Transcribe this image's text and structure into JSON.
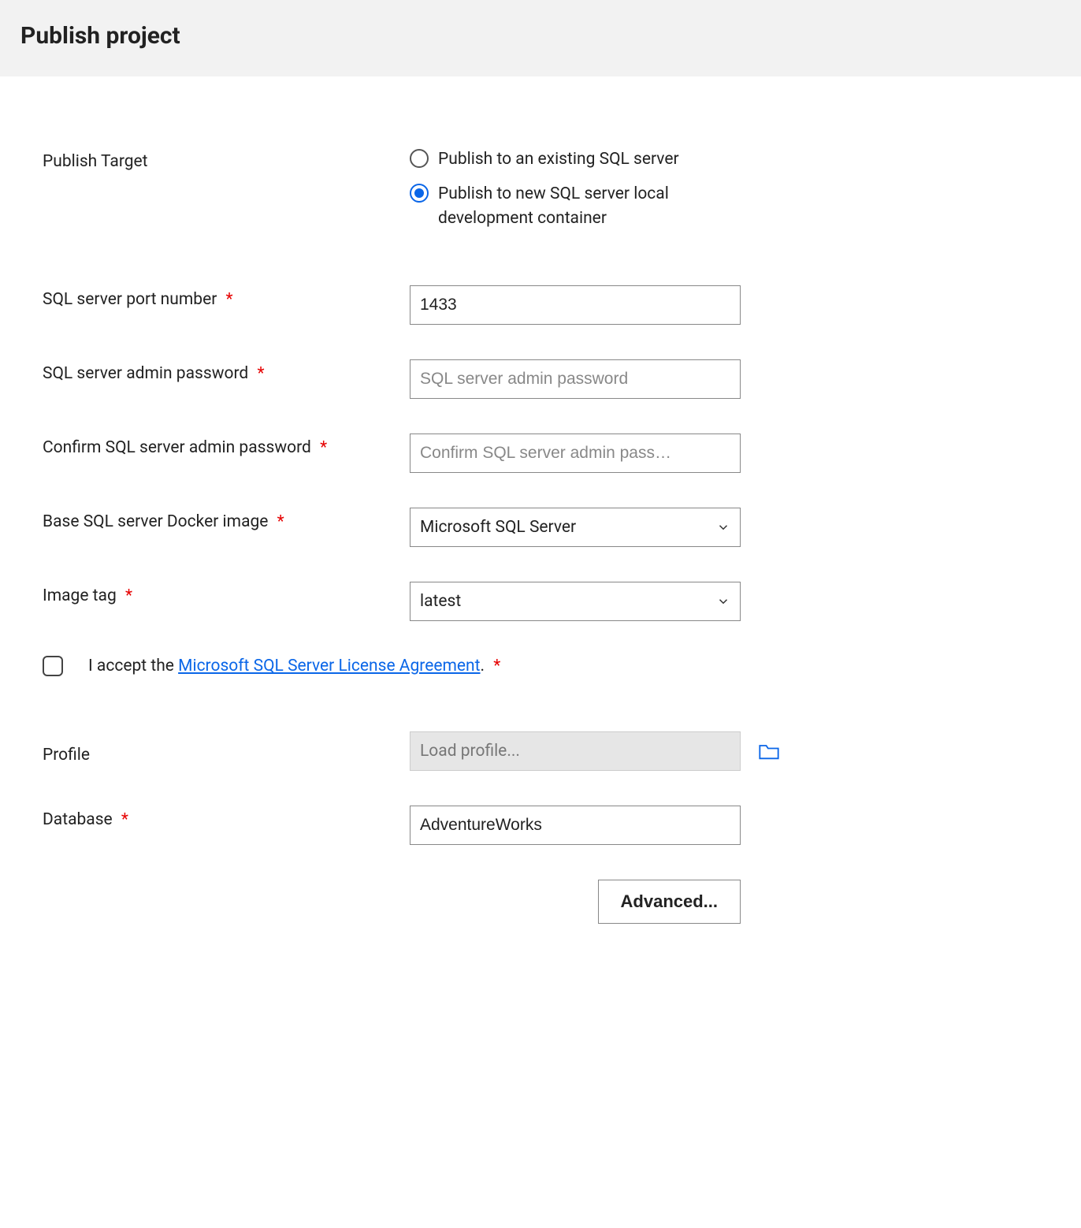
{
  "header": {
    "title": "Publish project"
  },
  "publishTarget": {
    "label": "Publish Target",
    "options": {
      "existing": "Publish to an existing SQL server",
      "newContainer": "Publish to new SQL server local development container"
    },
    "selected": "newContainer"
  },
  "fields": {
    "port": {
      "label": "SQL server port number",
      "value": "1433",
      "required": true
    },
    "adminPassword": {
      "label": "SQL server admin password",
      "placeholder": "SQL server admin password",
      "value": "",
      "required": true
    },
    "confirmPassword": {
      "label": "Confirm SQL server admin password",
      "placeholder": "Confirm SQL server admin pass…",
      "value": "",
      "required": true
    },
    "dockerImage": {
      "label": "Base SQL server Docker image",
      "value": "Microsoft SQL Server",
      "required": true
    },
    "imageTag": {
      "label": "Image tag",
      "value": "latest",
      "required": true
    },
    "profile": {
      "label": "Profile",
      "placeholder": "Load profile...",
      "value": ""
    },
    "database": {
      "label": "Database",
      "value": "AdventureWorks",
      "required": true
    }
  },
  "license": {
    "prefix": "I accept the ",
    "linkText": "Microsoft SQL Server License Agreement",
    "suffix": ".",
    "required": true,
    "checked": false
  },
  "buttons": {
    "advanced": "Advanced..."
  },
  "requiredMark": "*"
}
